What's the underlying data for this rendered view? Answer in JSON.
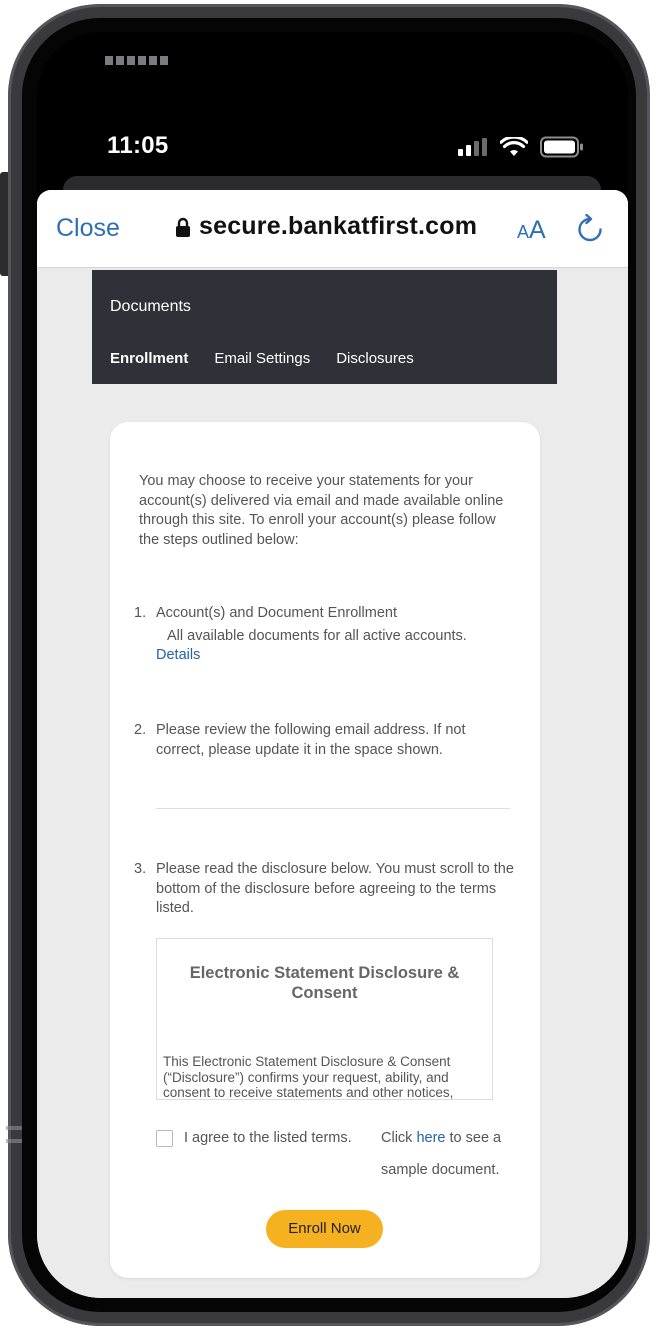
{
  "status_bar": {
    "time": "11:05",
    "icons": [
      "cellular-signal-icon",
      "wifi-icon",
      "battery-icon"
    ]
  },
  "browser": {
    "close_label": "Close",
    "url": "secure.bankatfirst.com",
    "text_size_small": "A",
    "text_size_large": "A",
    "icons": [
      "lock-icon",
      "reload-icon",
      "share-icon"
    ]
  },
  "documents": {
    "title": "Documents",
    "tabs": [
      {
        "label": "Enrollment",
        "active": true
      },
      {
        "label": "Email Settings",
        "active": false
      },
      {
        "label": "Disclosures",
        "active": false
      }
    ]
  },
  "enrollment": {
    "intro": "You may choose to receive your statements for your account(s) delivered via email and made available online through this site. To enroll your account(s) please follow the steps outlined below:",
    "step1": {
      "number": "1.",
      "title": "Account(s) and Document Enrollment",
      "detail": "All available documents for all active accounts.",
      "link": "Details"
    },
    "step2": {
      "number": "2.",
      "text": "Please review the following email address. If not correct, please update it in the space shown.",
      "email_value": ""
    },
    "step3": {
      "number": "3.",
      "text": "Please read the disclosure below. You must scroll to the bottom of the disclosure before agreeing to the terms listed."
    },
    "disclosure": {
      "title": "Electronic Statement Disclosure & Consent",
      "body": "This Electronic Statement Disclosure & Consent (“Disclosure”) confirms your request, ability, and consent to receive statements and other notices,"
    },
    "agree_label": "I agree to the listed terms.",
    "agree_checked": false,
    "click_prefix": "Click",
    "here_link": "here",
    "click_suffix": "to see a",
    "sample_text": "sample document.",
    "enroll_button": "Enroll Now"
  },
  "colors": {
    "accent": "#2e6fb5",
    "header_bg": "#2e3238",
    "button_bg": "#f5b120",
    "page_bg": "#ebebeb"
  }
}
